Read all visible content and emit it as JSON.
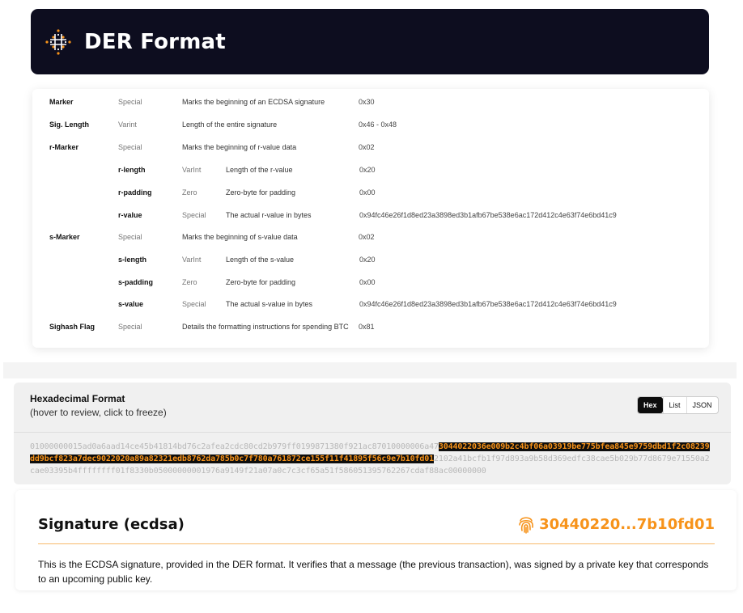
{
  "header": {
    "title": "DER Format"
  },
  "table": {
    "rows": [
      {
        "name": "Marker",
        "type": "Special",
        "desc": "Marks the beginning of an ECDSA signature",
        "value": "0x30"
      },
      {
        "name": "Sig. Length",
        "type": "Varint",
        "desc": "Length of the entire signature",
        "value": "0x46 - 0x48"
      },
      {
        "name": "r-Marker",
        "type": "Special",
        "desc": "Marks the beginning of r-value data",
        "value": "0x02"
      },
      {
        "name": "r-length",
        "type": "VarInt",
        "desc": "Length of the r-value",
        "value": "0x20"
      },
      {
        "name": "r-padding",
        "type": "Zero",
        "desc": "Zero-byte for padding",
        "value": "0x00"
      },
      {
        "name": "r-value",
        "type": "Special",
        "desc": "The actual r-value in bytes",
        "value": "0x94fc46e26f1d8ed23a3898ed3b1afb67be538e6ac172d412c4e63f74e6bd41c9"
      },
      {
        "name": "s-Marker",
        "type": "Special",
        "desc": "Marks the beginning of s-value data",
        "value": "0x02"
      },
      {
        "name": "s-length",
        "type": "VarInt",
        "desc": "Length of the s-value",
        "value": "0x20"
      },
      {
        "name": "s-padding",
        "type": "Zero",
        "desc": "Zero-byte for padding",
        "value": "0x00"
      },
      {
        "name": "s-value",
        "type": "Special",
        "desc": "The actual s-value in bytes",
        "value": "0x94fc46e26f1d8ed23a3898ed3b1afb67be538e6ac172d412c4e63f74e6bd41c9"
      },
      {
        "name": "Sighash Flag",
        "type": "Special",
        "desc": "Details the formatting instructions for spending BTC",
        "value": "0x81"
      }
    ]
  },
  "hex": {
    "title": "Hexadecimal Format",
    "subtitle": "(hover to review, click to freeze)",
    "toggle": {
      "hex": "Hex",
      "list": "List",
      "json": "JSON",
      "active": "Hex"
    },
    "before": "01000000015ad0a6aad14ce45b41814bd76c2afea2cdc80cd2b979ff0199871380f921ac87010000006a47",
    "highlight": "3044022036e009b2c4bf06a03919be775bfea845e9759dbd1f2c08239dd9bcf823a7dec9022020a89a8232",
    "highlight2": "1edb8762da785b0c7f780a761872ce155f11f41895f56c9e7b10fd01",
    "after": "2102a41bcfb1f97d893a9b58d369edfc38cae5b029b77d8679e71550a2cae03395b4ffffffff01f8330b05000000001976a9149f21a07a0c7c3cf65a51f586051395762267cdaf88ac00000000"
  },
  "signature": {
    "title": "Signature (ecdsa)",
    "value": "30440220...7b10fd01",
    "description": "This is the ECDSA signature, provided in the DER format. It verifies that a message (the previous transaction), was signed by a private key that corresponds to an upcoming public key."
  },
  "colors": {
    "accent": "#f7931a",
    "header_bg": "#0d0d1f",
    "highlight_bg": "#0d0d0d"
  }
}
